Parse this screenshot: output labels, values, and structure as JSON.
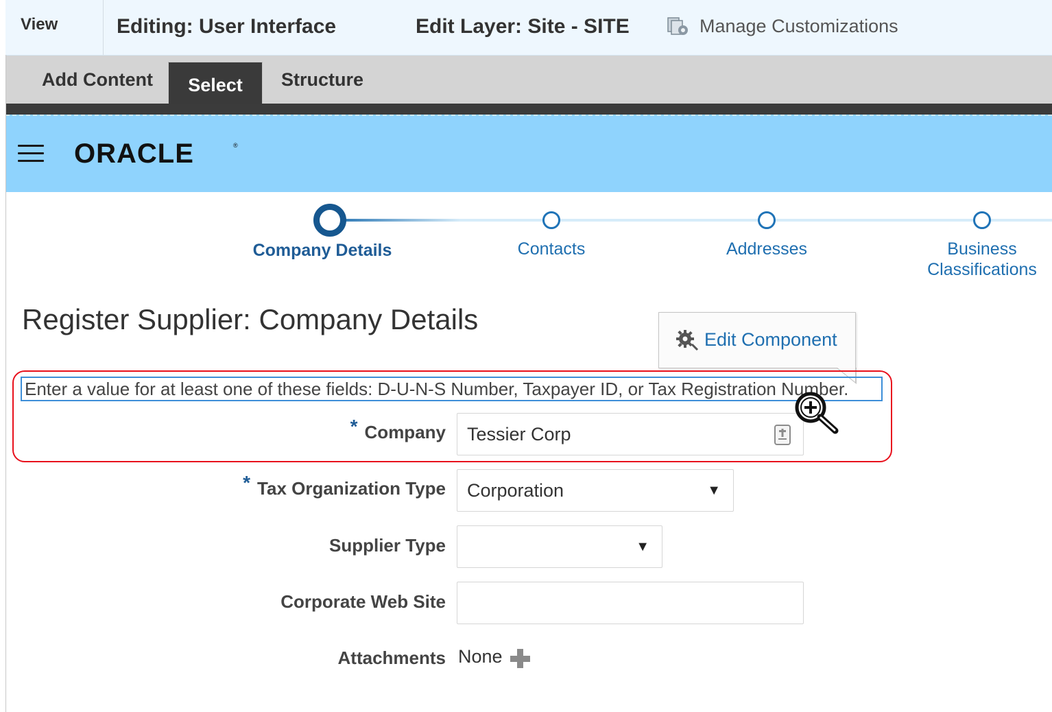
{
  "topbar": {
    "view_label": "View",
    "editing_label": "Editing: User Interface",
    "layer_label": "Edit Layer: Site - SITE",
    "manage_label": "Manage Customizations",
    "manage_icon": "manage-customizations-icon"
  },
  "modebar": {
    "tabs": [
      {
        "label": "Add Content",
        "selected": false
      },
      {
        "label": "Select",
        "selected": true
      },
      {
        "label": "Structure",
        "selected": false
      }
    ]
  },
  "header": {
    "menu_icon": "hamburger-menu-icon",
    "logo_text": "ORACLE"
  },
  "train": {
    "stops": [
      {
        "label": "Company Details",
        "current": true
      },
      {
        "label": "Contacts",
        "current": false
      },
      {
        "label": "Addresses",
        "current": false
      },
      {
        "label_line1": "Business",
        "label_line2": "Classifications",
        "current": false
      }
    ]
  },
  "main": {
    "page_title": "Register Supplier: Company Details",
    "edit_component_label": "Edit Component",
    "instruction": "Enter a value for at least one of these fields: D-U-N-S Number, Taxpayer ID, or Tax Registration Number.",
    "fields": {
      "company": {
        "label": "Company",
        "required_mark": "*",
        "value": "Tessier Corp"
      },
      "tax_org_type": {
        "label": "Tax Organization Type",
        "required_mark": "*",
        "value": "Corporation"
      },
      "supplier_type": {
        "label": "Supplier Type",
        "value": ""
      },
      "corporate_web_site": {
        "label": "Corporate Web Site",
        "value": ""
      },
      "attachments": {
        "label": "Attachments",
        "value": "None"
      }
    },
    "dropdown_arrow": "▼"
  },
  "colors": {
    "header_blue": "#8fd3fd",
    "link_blue": "#1f6fb0",
    "selection_red": "#e8101c",
    "dark_bar": "#3b3b3b"
  }
}
